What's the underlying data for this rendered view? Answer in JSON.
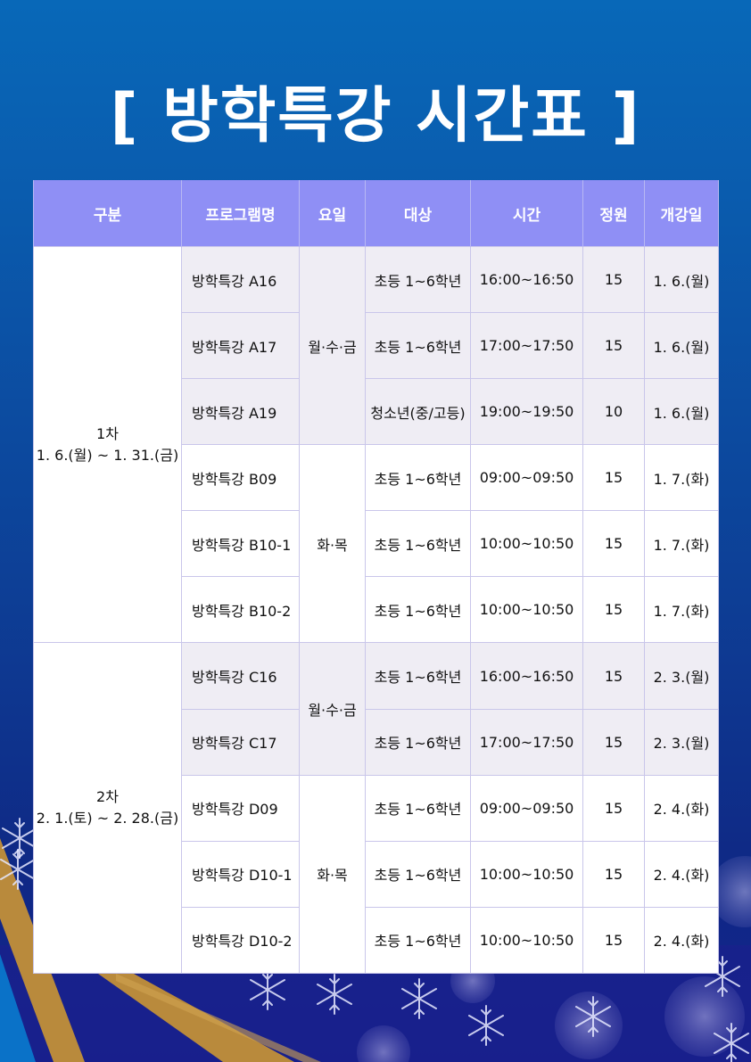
{
  "title": "[ 방학특강 시간표 ]",
  "headers": [
    "구분",
    "프로그램명",
    "요일",
    "대상",
    "시간",
    "정원",
    "개강일"
  ],
  "terms": [
    {
      "name": "1차",
      "period": "1. 6.(월) ~ 1. 31.(금)"
    },
    {
      "name": "2차",
      "period": "2. 1.(토) ~ 2. 28.(금)"
    }
  ],
  "day_groups": [
    "월·수·금",
    "화·목",
    "월·수·금",
    "화·목"
  ],
  "rows": [
    {
      "program": "방학특강 A16",
      "target": "초등 1~6학년",
      "time": "16:00~16:50",
      "capacity": "15",
      "start": "1. 6.(월)"
    },
    {
      "program": "방학특강 A17",
      "target": "초등 1~6학년",
      "time": "17:00~17:50",
      "capacity": "15",
      "start": "1. 6.(월)"
    },
    {
      "program": "방학특강 A19",
      "target": "청소년(중/고등)",
      "time": "19:00~19:50",
      "capacity": "10",
      "start": "1. 6.(월)"
    },
    {
      "program": "방학특강 B09",
      "target": "초등 1~6학년",
      "time": "09:00~09:50",
      "capacity": "15",
      "start": "1. 7.(화)"
    },
    {
      "program": "방학특강 B10-1",
      "target": "초등 1~6학년",
      "time": "10:00~10:50",
      "capacity": "15",
      "start": "1. 7.(화)"
    },
    {
      "program": "방학특강 B10-2",
      "target": "초등 1~6학년",
      "time": "10:00~10:50",
      "capacity": "15",
      "start": "1. 7.(화)"
    },
    {
      "program": "방학특강 C16",
      "target": "초등 1~6학년",
      "time": "16:00~16:50",
      "capacity": "15",
      "start": "2. 3.(월)"
    },
    {
      "program": "방학특강 C17",
      "target": "초등 1~6학년",
      "time": "17:00~17:50",
      "capacity": "15",
      "start": "2. 3.(월)"
    },
    {
      "program": "방학특강 D09",
      "target": "초등 1~6학년",
      "time": "09:00~09:50",
      "capacity": "15",
      "start": "2. 4.(화)"
    },
    {
      "program": "방학특강 D10-1",
      "target": "초등 1~6학년",
      "time": "10:00~10:50",
      "capacity": "15",
      "start": "2. 4.(화)"
    },
    {
      "program": "방학특강 D10-2",
      "target": "초등 1~6학년",
      "time": "10:00~10:50",
      "capacity": "15",
      "start": "2. 4.(화)"
    }
  ],
  "colors": {
    "header": "#8f8ff5",
    "shaded_row": "#efedf4",
    "background": "#0a5cae",
    "ribbon": "#b98a3c"
  }
}
